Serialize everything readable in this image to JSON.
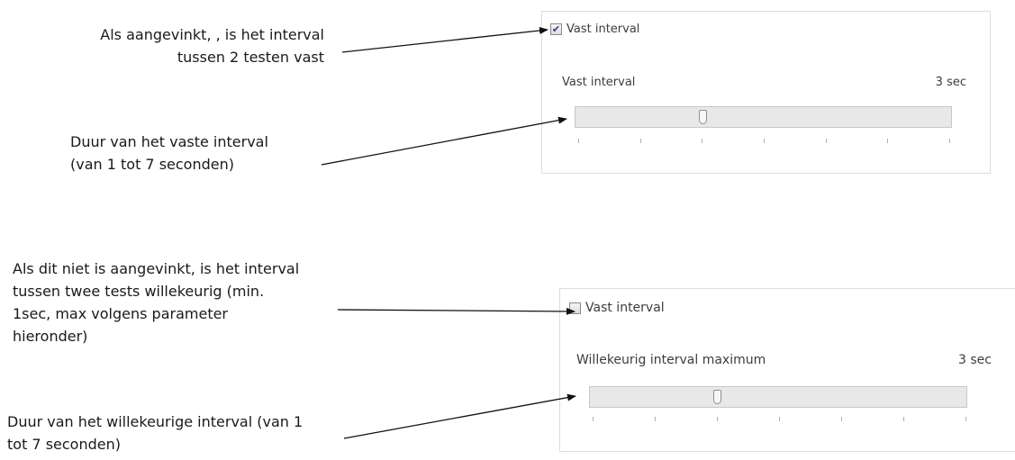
{
  "annotations": {
    "fixed_checked": [
      "Als aangevinkt, , is het interval",
      "tussen 2 testen vast"
    ],
    "fixed_duration": [
      "Duur van het vaste interval",
      "(van 1 tot 7 seconden)"
    ],
    "random_unchecked": [
      "Als dit niet is aangevinkt, is het interval",
      "tussen twee tests willekeurig (min.",
      "1sec, max volgens parameter",
      "hieronder)"
    ],
    "random_duration": [
      "Duur van het willekeurige interval (van 1",
      "tot 7 seconden)"
    ]
  },
  "panel_fixed": {
    "checkbox_label": "Vast interval",
    "checked": true,
    "check_mark": "✔",
    "slider_label": "Vast interval",
    "slider_value_text": "3 sec",
    "slider": {
      "min": 1,
      "max": 7,
      "value": 3
    }
  },
  "panel_random": {
    "checkbox_label": "Vast interval",
    "checked": false,
    "check_mark": "",
    "slider_label": "Willekeurig interval maximum",
    "slider_value_text": "3 sec",
    "slider": {
      "min": 1,
      "max": 7,
      "value": 3
    }
  }
}
